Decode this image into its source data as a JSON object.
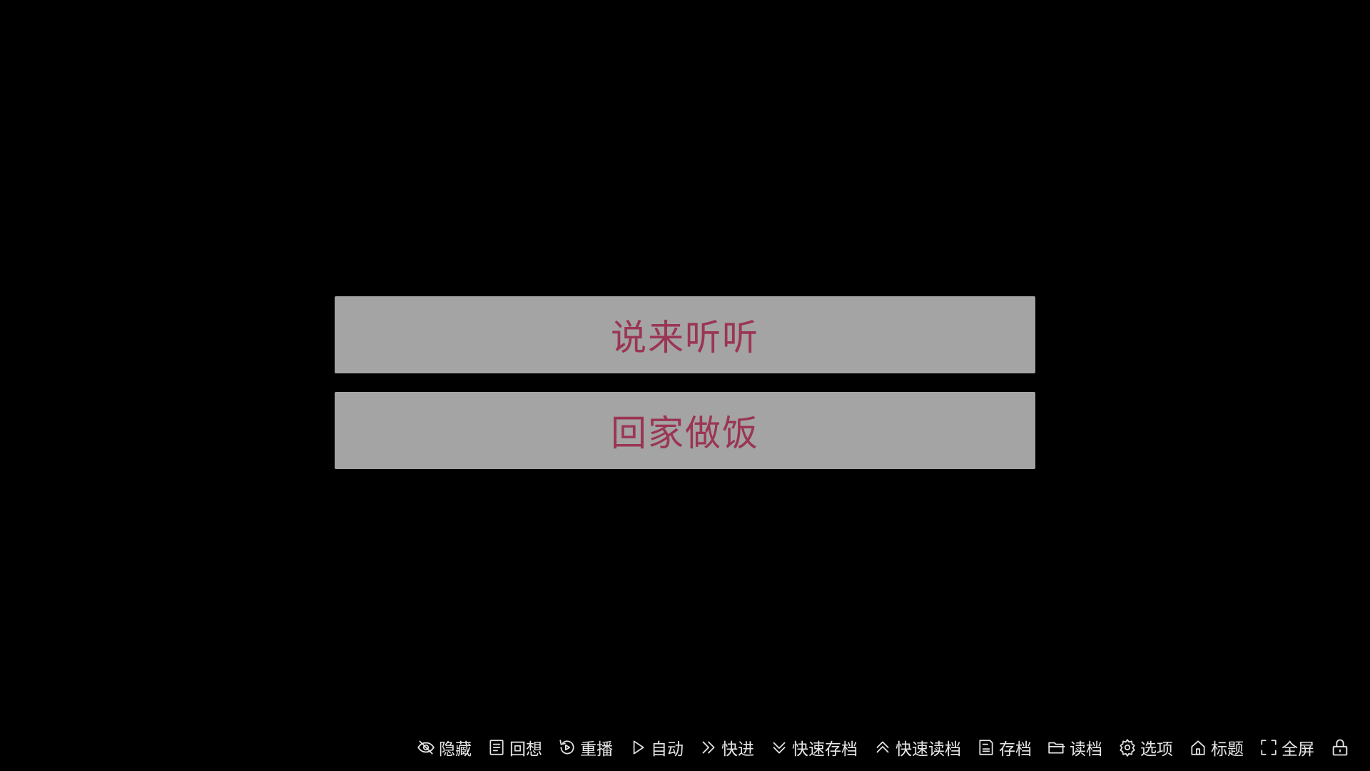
{
  "choices": [
    {
      "label": "说来听听"
    },
    {
      "label": "回家做饭"
    }
  ],
  "quick_menu": {
    "items": [
      {
        "label": "隐藏",
        "icon": "eye-off-icon"
      },
      {
        "label": "回想",
        "icon": "history-icon"
      },
      {
        "label": "重播",
        "icon": "replay-icon"
      },
      {
        "label": "自动",
        "icon": "play-icon"
      },
      {
        "label": "快进",
        "icon": "fast-forward-icon"
      },
      {
        "label": "快速存档",
        "icon": "chevron-down-icon"
      },
      {
        "label": "快速读档",
        "icon": "chevron-up-icon"
      },
      {
        "label": "存档",
        "icon": "save-icon"
      },
      {
        "label": "读档",
        "icon": "folder-icon"
      },
      {
        "label": "选项",
        "icon": "gear-icon"
      },
      {
        "label": "标题",
        "icon": "home-icon"
      },
      {
        "label": "全屏",
        "icon": "fullscreen-icon"
      }
    ],
    "lock_icon": "lock-icon"
  },
  "colors": {
    "background": "#000000",
    "choice_background": "#a4a4a4",
    "choice_text": "#9b3554",
    "menu_text": "#e6e6e6"
  }
}
